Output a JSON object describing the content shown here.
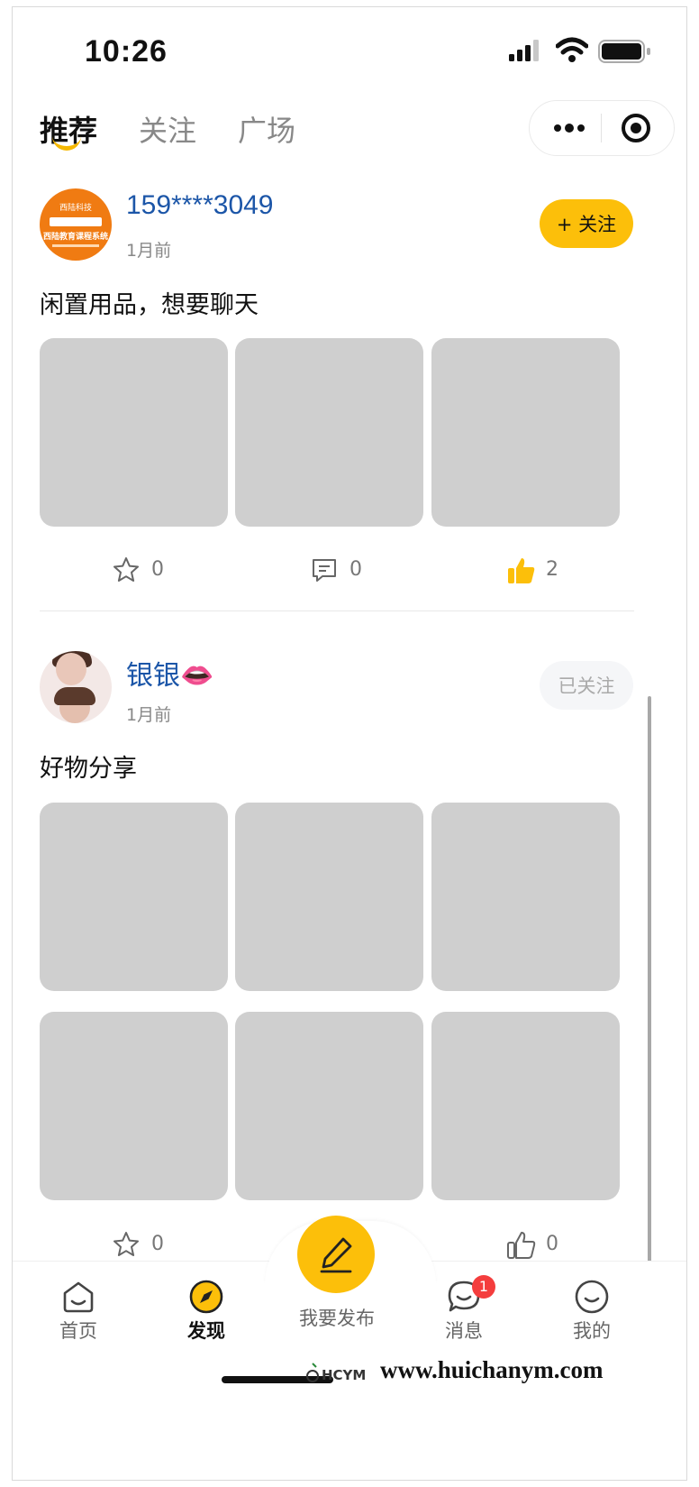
{
  "status_bar": {
    "time": "10:26"
  },
  "top_tabs": [
    {
      "label": "推荐",
      "active": true
    },
    {
      "label": "关注",
      "active": false
    },
    {
      "label": "广场",
      "active": false
    }
  ],
  "accent_color": "#fcbf0a",
  "posts": [
    {
      "username": "159****3049",
      "time": "1月前",
      "follow_label": "+ 关注",
      "followed": false,
      "text": "闲置用品，想要聊天",
      "avatar_text": {
        "line1": "西陆科技",
        "line3": "西陆教育课程系统"
      },
      "image_count": 3,
      "stats": {
        "favorites": "0",
        "comments": "0",
        "likes": "2"
      }
    },
    {
      "username": "银银👄",
      "time": "1月前",
      "follow_label": "已关注",
      "followed": true,
      "text": "好物分享",
      "image_count": 6,
      "stats": {
        "favorites": "0",
        "likes": "0"
      }
    }
  ],
  "tabbar": {
    "items": [
      {
        "label": "首页",
        "icon": "home-icon"
      },
      {
        "label": "发现",
        "icon": "compass-icon",
        "active": true
      },
      {
        "label": "我要发布",
        "icon": "pencil-icon"
      },
      {
        "label": "消息",
        "icon": "chat-icon",
        "badge": "1"
      },
      {
        "label": "我的",
        "icon": "profile-icon"
      }
    ]
  },
  "watermark": {
    "logo_text": "HCYM",
    "url": "www.huichanym.com"
  }
}
